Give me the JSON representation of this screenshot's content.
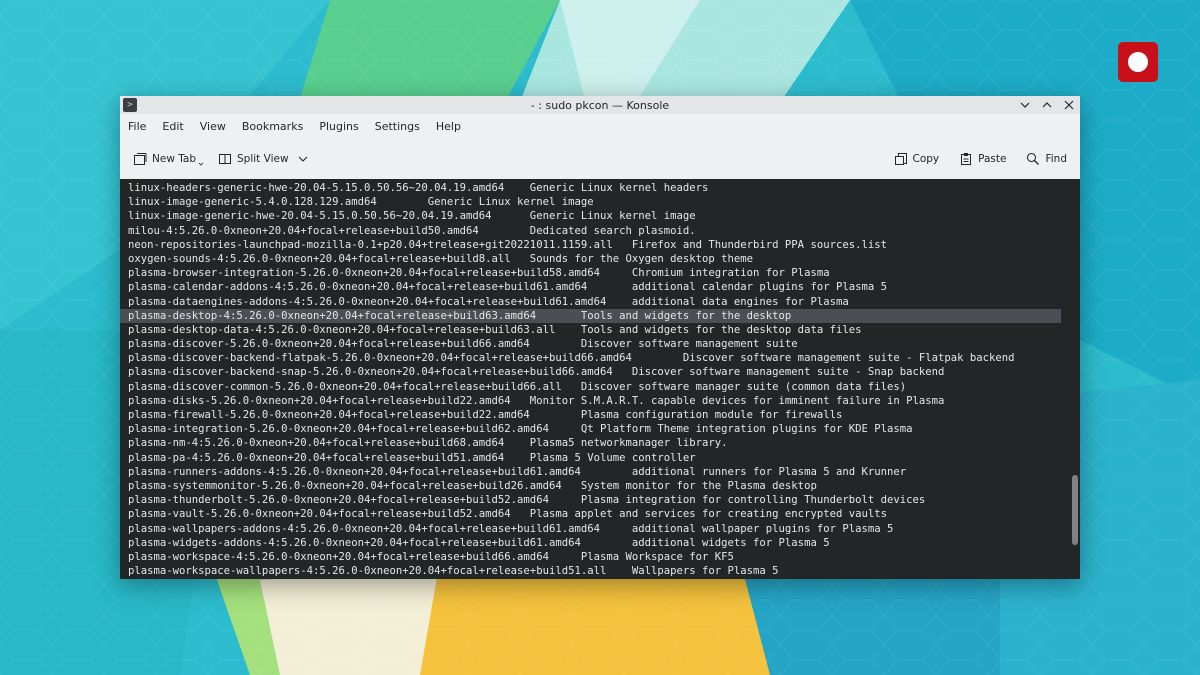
{
  "window": {
    "title": "- : sudo pkcon — Konsole",
    "app_icon_glyph": ">"
  },
  "menu": [
    "File",
    "Edit",
    "View",
    "Bookmarks",
    "Plugins",
    "Settings",
    "Help"
  ],
  "toolbar": {
    "new_tab": "New Tab",
    "split_view": "Split View",
    "copy": "Copy",
    "paste": "Paste",
    "find": "Find"
  },
  "colors": {
    "terminal_bg": "#232627",
    "terminal_fg": "#e6e6e6",
    "highlight": "#4b4f53",
    "record": "#c8101a"
  },
  "terminal": {
    "highlighted_index": 9,
    "lines": [
      "linux-headers-generic-hwe-20.04-5.15.0.50.56~20.04.19.amd64    Generic Linux kernel headers",
      "linux-image-generic-5.4.0.128.129.amd64        Generic Linux kernel image",
      "linux-image-generic-hwe-20.04-5.15.0.50.56~20.04.19.amd64      Generic Linux kernel image",
      "milou-4:5.26.0-0xneon+20.04+focal+release+build50.amd64        Dedicated search plasmoid.",
      "neon-repositories-launchpad-mozilla-0.1+p20.04+trelease+git20221011.1159.all   Firefox and Thunderbird PPA sources.list",
      "oxygen-sounds-4:5.26.0-0xneon+20.04+focal+release+build8.all   Sounds for the Oxygen desktop theme",
      "plasma-browser-integration-5.26.0-0xneon+20.04+focal+release+build58.amd64     Chromium integration for Plasma",
      "plasma-calendar-addons-4:5.26.0-0xneon+20.04+focal+release+build61.amd64       additional calendar plugins for Plasma 5",
      "plasma-dataengines-addons-4:5.26.0-0xneon+20.04+focal+release+build61.amd64    additional data engines for Plasma",
      "plasma-desktop-4:5.26.0-0xneon+20.04+focal+release+build63.amd64       Tools and widgets for the desktop",
      "plasma-desktop-data-4:5.26.0-0xneon+20.04+focal+release+build63.all    Tools and widgets for the desktop data files",
      "plasma-discover-5.26.0-0xneon+20.04+focal+release+build66.amd64        Discover software management suite",
      "plasma-discover-backend-flatpak-5.26.0-0xneon+20.04+focal+release+build66.amd64        Discover software management suite - Flatpak backend",
      "plasma-discover-backend-snap-5.26.0-0xneon+20.04+focal+release+build66.amd64   Discover software management suite - Snap backend",
      "plasma-discover-common-5.26.0-0xneon+20.04+focal+release+build66.all   Discover software manager suite (common data files)",
      "plasma-disks-5.26.0-0xneon+20.04+focal+release+build22.amd64   Monitor S.M.A.R.T. capable devices for imminent failure in Plasma",
      "plasma-firewall-5.26.0-0xneon+20.04+focal+release+build22.amd64        Plasma configuration module for firewalls",
      "plasma-integration-5.26.0-0xneon+20.04+focal+release+build62.amd64     Qt Platform Theme integration plugins for KDE Plasma",
      "plasma-nm-4:5.26.0-0xneon+20.04+focal+release+build68.amd64    Plasma5 networkmanager library.",
      "plasma-pa-4:5.26.0-0xneon+20.04+focal+release+build51.amd64    Plasma 5 Volume controller",
      "plasma-runners-addons-4:5.26.0-0xneon+20.04+focal+release+build61.amd64        additional runners for Plasma 5 and Krunner",
      "plasma-systemmonitor-5.26.0-0xneon+20.04+focal+release+build26.amd64   System monitor for the Plasma desktop",
      "plasma-thunderbolt-5.26.0-0xneon+20.04+focal+release+build52.amd64     Plasma integration for controlling Thunderbolt devices",
      "plasma-vault-5.26.0-0xneon+20.04+focal+release+build52.amd64   Plasma applet and services for creating encrypted vaults",
      "plasma-wallpapers-addons-4:5.26.0-0xneon+20.04+focal+release+build61.amd64     additional wallpaper plugins for Plasma 5",
      "plasma-widgets-addons-4:5.26.0-0xneon+20.04+focal+release+build61.amd64        additional widgets for Plasma 5",
      "plasma-workspace-4:5.26.0-0xneon+20.04+focal+release+build66.amd64     Plasma Workspace for KF5",
      "plasma-workspace-wallpapers-4:5.26.0-0xneon+20.04+focal+release+build51.all    Wallpapers for Plasma 5"
    ]
  }
}
